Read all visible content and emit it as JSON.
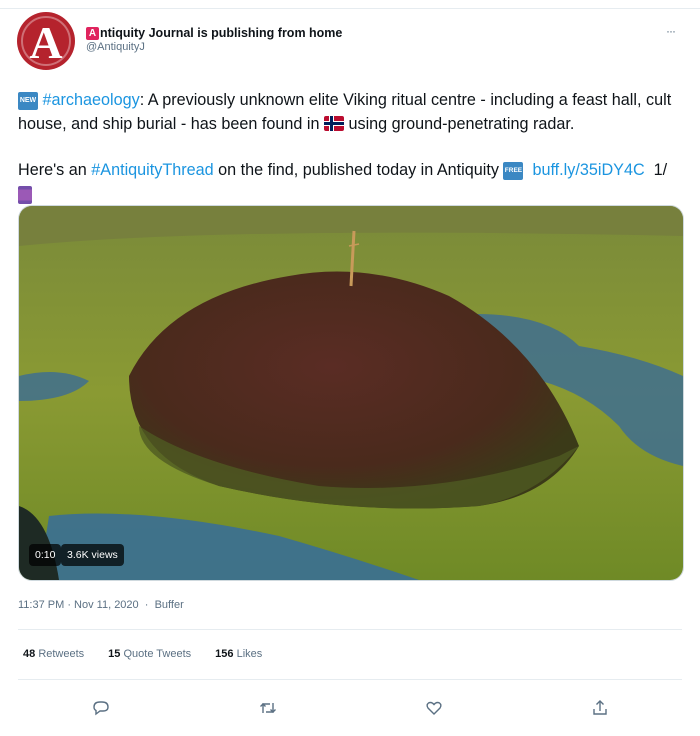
{
  "account": {
    "name": "ntiquity Journal is publishing from home",
    "logo_letter": "A",
    "handle": "@AntiquityJ"
  },
  "more_label": "···",
  "tweet": {
    "new_emoji": "NEW",
    "hashtag1": "#archaeology",
    "line1_rest": ": A previously unknown elite Viking ritual centre - including a feast hall, cult house, and ship burial - has been found in",
    "line1_end": "using ground-penetrating radar.",
    "line2_start": "Here's an",
    "hashtag2": "#AntiquityThread",
    "line2_mid": "on the find, published today in Antiquity",
    "free_emoji": "FREE",
    "link": "buff.ly/35iDY4C",
    "thread_count": "1/"
  },
  "media": {
    "duration": "0:10",
    "views": "3.6K views"
  },
  "meta": {
    "time": "11:37 PM · Nov 11, 2020",
    "dot": "·",
    "source": "Buffer"
  },
  "stats": {
    "retweets_count": "48",
    "retweets_label": "Retweets",
    "quotes_count": "15",
    "quotes_label": "Quote Tweets",
    "likes_count": "156",
    "likes_label": "Likes"
  },
  "icons": [
    "reply-icon",
    "retweet-icon",
    "like-icon",
    "share-icon"
  ],
  "colors": {
    "link": "#1b95e0",
    "muted": "#5b7083",
    "brand": "#b5232d"
  }
}
